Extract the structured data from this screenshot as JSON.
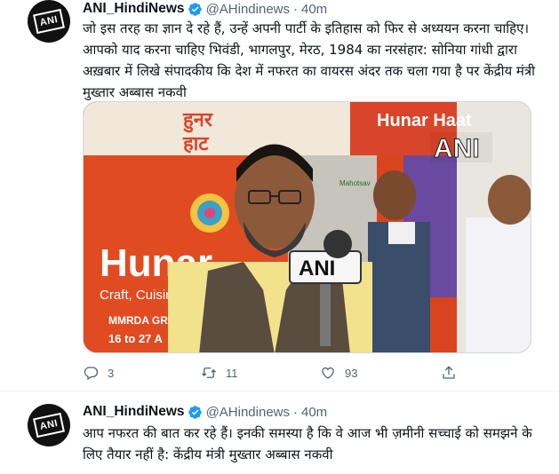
{
  "tweets": [
    {
      "author": {
        "name": "ANI_HindiNews",
        "handle": "@AHindinews",
        "time": "40m",
        "avatar_text": "ANI",
        "verified": true
      },
      "text": "जो इस तरह का ज्ञान दे रहे हैं, उन्हें अपनी पार्टी के इतिहास को फिर से अध्ययन करना चाहिए। आपको याद करना चाहिए भिवंडी, भागलपुर, मेरठ, 1984 का नरसंहार: सोनिया गांधी द्वारा अख़बार में लिखे संपादकीय कि देश में नफरत का वायरस अंदर तक चला गया है पर केंद्रीय मंत्री मुख्तार अब्बास नकवी",
      "media": {
        "watermark": "ANI",
        "banner_top_hindi_1": "हुनर",
        "banner_top_hindi_2": "हाट",
        "banner_top_english": "Hunar Haat",
        "banner_main": "Hunar",
        "banner_sub": "Craft, Cuisine",
        "banner_venue": "MMRDA GRO",
        "banner_dates": "16 to 27 A",
        "mahotsav": "Mahotsav",
        "mic_label": "ANI"
      },
      "actions": {
        "reply_count": "3",
        "retweet_count": "11",
        "like_count": "93"
      }
    },
    {
      "author": {
        "name": "ANI_HindiNews",
        "handle": "@AHindinews",
        "time": "40m",
        "avatar_text": "ANI",
        "verified": true
      },
      "text": "आप नफरत की बात कर रहे हैं। इनकी समस्या है कि वे आज भी ज़मीनी सच्चाई को समझने के लिए तैयार नहीं है: केंद्रीय मंत्री मुख्तार अब्बास नकवी"
    }
  ],
  "colors": {
    "verified_badge": "#1d9bf0",
    "secondary_text": "#536471",
    "avatar_bg": "#111111"
  },
  "icons": {
    "reply": "reply-icon",
    "retweet": "retweet-icon",
    "like": "heart-icon",
    "share": "share-icon",
    "verified": "verified-badge-icon"
  }
}
